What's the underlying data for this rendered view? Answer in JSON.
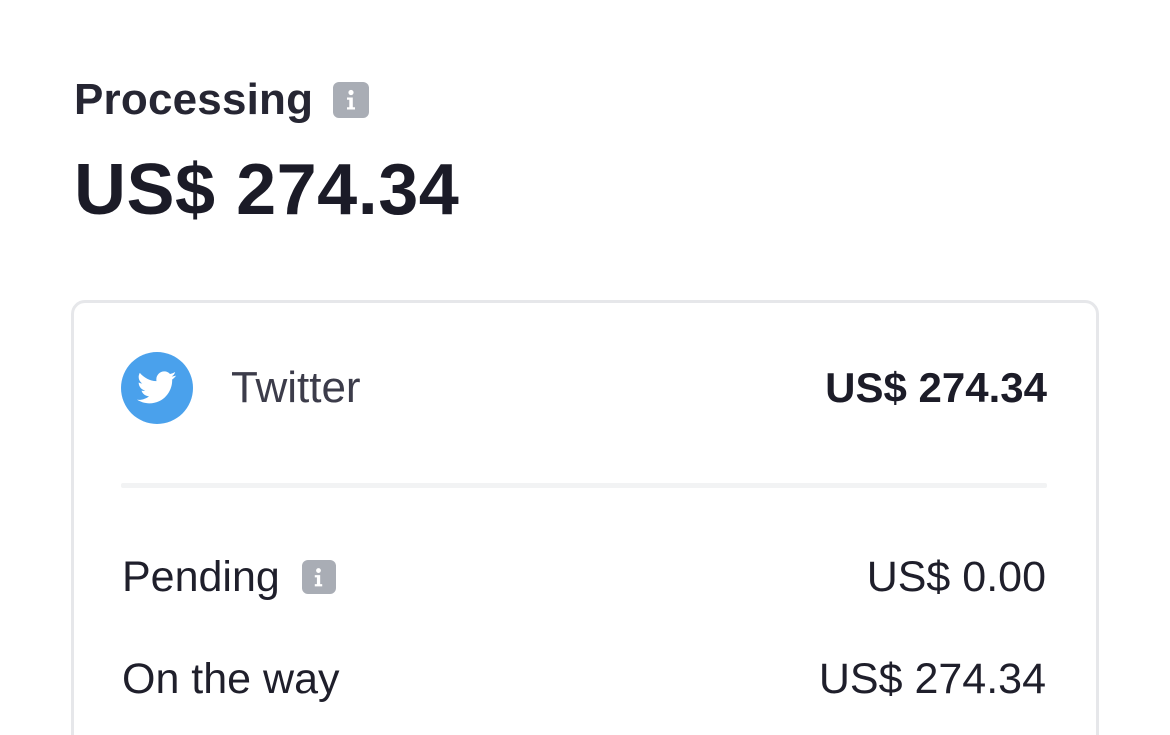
{
  "header": {
    "title": "Processing",
    "title_info_icon": "info-icon",
    "amount": "US$ 274.34"
  },
  "account": {
    "icon": "twitter-bird-icon",
    "icon_color": "#4aa1ec",
    "name": "Twitter",
    "amount": "US$ 274.34"
  },
  "details": [
    {
      "label": "Pending",
      "has_info_icon": true,
      "value": "US$ 0.00"
    },
    {
      "label": "On the way",
      "has_info_icon": false,
      "value": "US$ 274.34"
    }
  ]
}
